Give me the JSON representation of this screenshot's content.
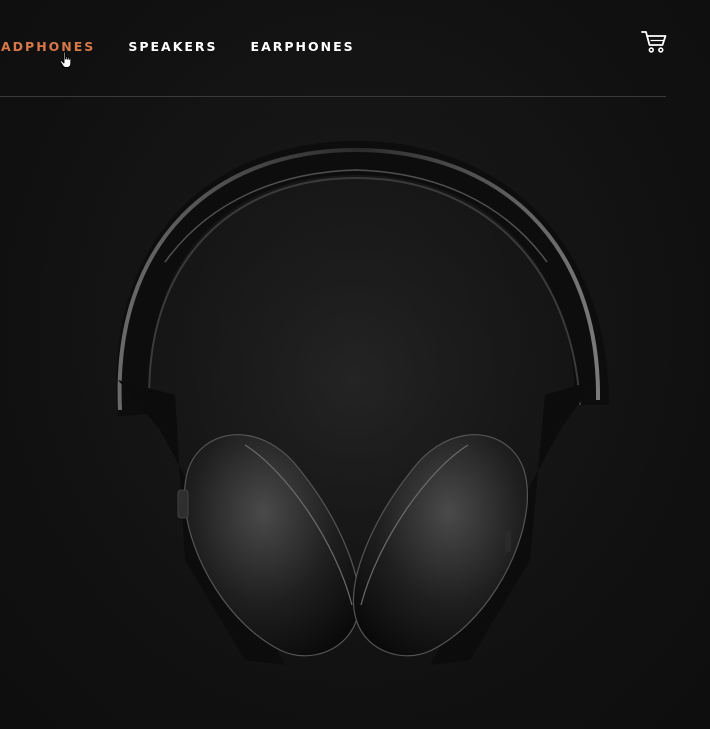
{
  "nav": {
    "links": [
      {
        "label": "HEADPHONES",
        "active": true
      },
      {
        "label": "SPEAKERS",
        "active": false
      },
      {
        "label": "EARPHONES",
        "active": false
      }
    ],
    "active_color": "#d8774a",
    "text_color": "#ffffff"
  },
  "icons": {
    "cart": "cart-icon",
    "cursor": "hand-pointer-icon"
  },
  "hero": {
    "image": "headphones-image",
    "background_color": "#101010"
  }
}
